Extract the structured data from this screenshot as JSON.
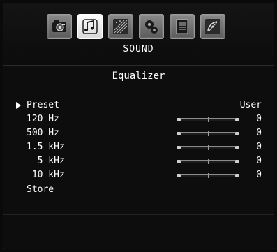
{
  "tabs": [
    {
      "name": "camera-icon",
      "active": false
    },
    {
      "name": "sound-note-icon",
      "active": true
    },
    {
      "name": "stars-icon",
      "active": false
    },
    {
      "name": "gears-icon",
      "active": false
    },
    {
      "name": "document-icon",
      "active": false
    },
    {
      "name": "satellite-icon",
      "active": false
    }
  ],
  "section_title": "SOUND",
  "panel_title": "Equalizer",
  "rows": [
    {
      "label": "Preset",
      "value": "User",
      "selected": true
    },
    {
      "label": "120 Hz",
      "value": "0",
      "level": 0
    },
    {
      "label": "500 Hz",
      "value": "0",
      "level": 0
    },
    {
      "label": "1.5 kHz",
      "value": "0",
      "level": 0
    },
    {
      "label": "  5 kHz",
      "value": "0",
      "level": 0
    },
    {
      "label": " 10 kHz",
      "value": "0",
      "level": 0
    },
    {
      "label": "Store"
    }
  ],
  "colors": {
    "background": "#0d0d0d",
    "text": "#ffffff",
    "tab_active": "#ffffff",
    "tab_inactive": "#7a7a7a"
  }
}
